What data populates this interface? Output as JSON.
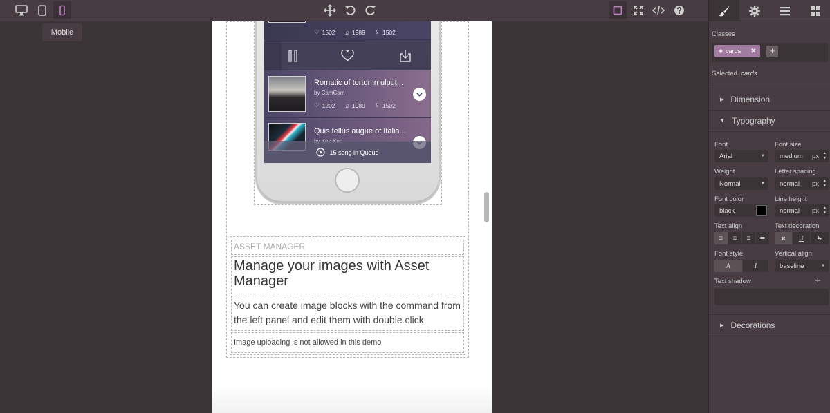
{
  "toolbar": {
    "devices": [
      {
        "name": "desktop-icon",
        "active": false
      },
      {
        "name": "tablet-icon",
        "active": false
      },
      {
        "name": "mobile-icon",
        "active": true
      }
    ],
    "tooltip": "Mobile",
    "accent": "#c07fc4"
  },
  "phone": {
    "songs": [
      {
        "title": "",
        "by": "",
        "likes": "1502",
        "plays": "1989",
        "shares": "1502"
      },
      {
        "title": "Romatic of tortor in ulput...",
        "by": "by CamCam",
        "likes": "1202",
        "plays": "1989",
        "shares": "1502"
      },
      {
        "title": "Quis tellus augue of Italia...",
        "by": "by Keo Keo"
      }
    ],
    "queue": "15 song in Queue"
  },
  "asset": {
    "label": "ASSET MANAGER",
    "title": "Manage your images with Asset Manager",
    "description": "You can create image blocks with the command from the left panel and edit them with double click",
    "note": "Image uploading is not allowed in this demo"
  },
  "panel": {
    "classes_label": "Classes",
    "tag": "cards",
    "selected_prefix": "Selected",
    "selected_value": ".cards",
    "sectors": {
      "dimension": "Dimension",
      "typography": "Typography",
      "decorations": "Decorations"
    },
    "font": {
      "label": "Font",
      "value": "Arial"
    },
    "font_size": {
      "label": "Font size",
      "value": "medium",
      "unit": "px"
    },
    "weight": {
      "label": "Weight",
      "value": "Normal"
    },
    "letter_spacing": {
      "label": "Letter spacing",
      "value": "normal",
      "unit": "px"
    },
    "font_color": {
      "label": "Font color",
      "value": "black"
    },
    "line_height": {
      "label": "Line height",
      "value": "normal",
      "unit": "px"
    },
    "text_align": {
      "label": "Text align"
    },
    "text_decoration": {
      "label": "Text decoration"
    },
    "font_style": {
      "label": "Font style"
    },
    "vertical_align": {
      "label": "Vertical align",
      "value": "baseline"
    },
    "text_shadow": {
      "label": "Text shadow"
    }
  }
}
